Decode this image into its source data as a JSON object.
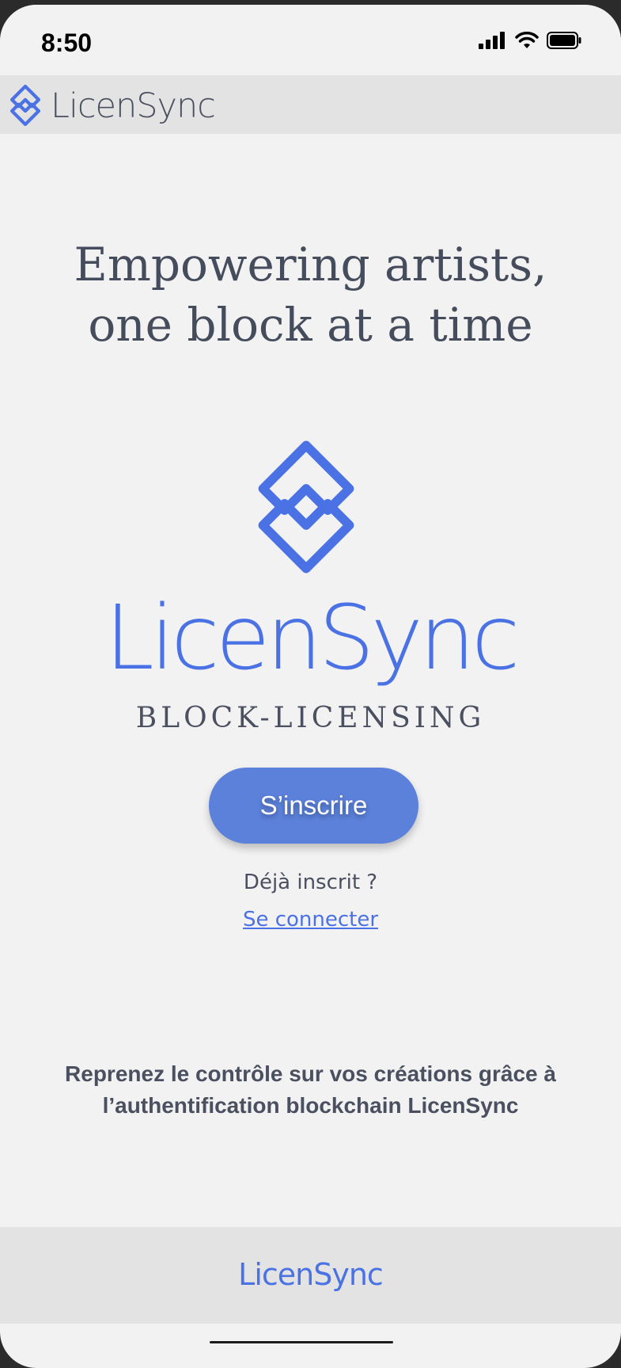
{
  "status_bar": {
    "time": "8:50",
    "icons": [
      "cellular-signal-icon",
      "wifi-icon",
      "battery-icon"
    ]
  },
  "header": {
    "brand": "LicenSync",
    "logo_icon": "licensync-logo-icon"
  },
  "hero": {
    "headline_line1": "Empowering artists,",
    "headline_line2": "one block at a time",
    "logo_icon": "licensync-logo-icon",
    "brand": "LicenSync",
    "tagline": "BLOCK-LICENSING"
  },
  "auth": {
    "signup_label": "S’inscrire",
    "already_text": "Déjà inscrit ?",
    "login_label": "Se connecter"
  },
  "bottom_text": "Reprenez le contrôle sur vos créations grâce à l’authentification blockchain LicenSync",
  "footer": {
    "brand": "LicenSync"
  },
  "colors": {
    "accent": "#4a72e4",
    "button": "#5b81da",
    "text": "#4a5060",
    "background": "#f2f2f2",
    "bar": "#e3e3e3"
  }
}
